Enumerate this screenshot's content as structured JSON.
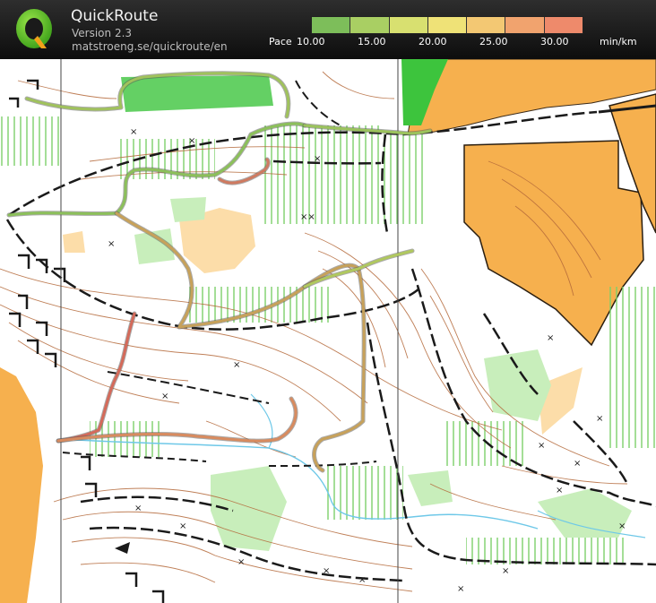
{
  "header": {
    "title": "QuickRoute",
    "version": "Version 2.3",
    "url": "matstroeng.se/quickroute/en"
  },
  "legend": {
    "label": "Pace",
    "ticks": [
      "10.00",
      "15.00",
      "20.00",
      "25.00",
      "30.00"
    ],
    "unit": "min/km",
    "colors": [
      "#7dbe5a",
      "#a9cf63",
      "#d8e070",
      "#efe277",
      "#f3c873",
      "#f1a36e",
      "#ee8a6b"
    ]
  },
  "colors": {
    "forest_open": "#f6b04e",
    "green_light": "#c8eebb",
    "green_dark": "#3dc43d",
    "contour": "#b4693a",
    "water": "#6ec8e8",
    "route_fast": "#8cc05a",
    "route_slow": "#d46a5a"
  }
}
